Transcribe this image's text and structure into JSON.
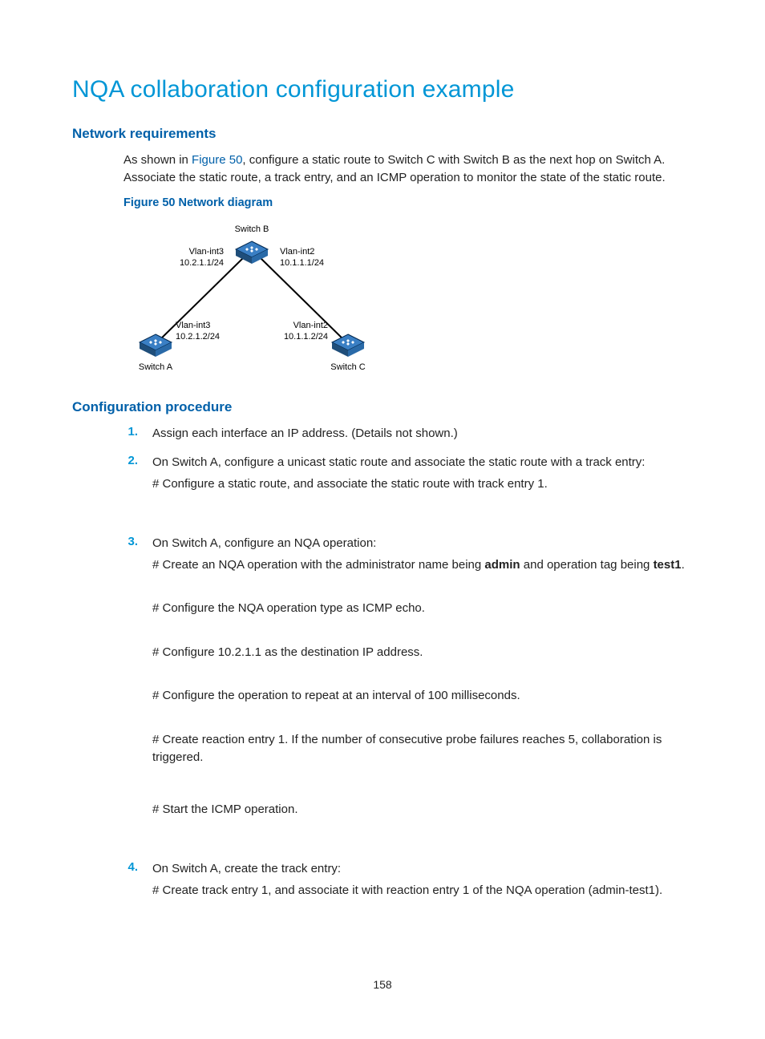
{
  "title": "NQA collaboration configuration example",
  "sections": {
    "netreq": {
      "heading": "Network requirements",
      "intro_pre": "As shown in ",
      "intro_link": "Figure 50",
      "intro_post": ", configure a static route to Switch C with Switch B as the next hop on Switch A. Associate the static route, a track entry, and an ICMP operation to monitor the state of the static route.",
      "fig_caption": "Figure 50 Network diagram"
    },
    "diagram": {
      "switch_b": "Switch B",
      "switch_a": "Switch A",
      "switch_c": "Switch C",
      "b_left_if": "Vlan-int3",
      "b_left_ip": "10.2.1.1/24",
      "b_right_if": "Vlan-int2",
      "b_right_ip": "10.1.1.1/24",
      "a_if": "Vlan-int3",
      "a_ip": "10.2.1.2/24",
      "c_if": "Vlan-int2",
      "c_ip": "10.1.1.2/24"
    },
    "config": {
      "heading": "Configuration procedure",
      "steps": [
        {
          "n": "1.",
          "lines": [
            "Assign each interface an IP address. (Details not shown.)"
          ]
        },
        {
          "n": "2.",
          "lines": [
            "On Switch A, configure a unicast static route and associate the static route with a track entry:",
            "# Configure a static route, and associate the static route with track entry 1."
          ]
        },
        {
          "n": "3.",
          "lines": [
            "On Switch A, configure an NQA operation:"
          ],
          "rich_line": {
            "pre": "# Create an NQA operation with the administrator name being ",
            "b1": "admin",
            "mid": " and operation tag being ",
            "b2": "test1",
            "post": "."
          },
          "after": [
            "# Configure the NQA operation type as ICMP echo.",
            "# Configure 10.2.1.1 as the destination IP address.",
            "# Configure the operation to repeat at an interval of 100 milliseconds.",
            "# Create reaction entry 1. If the number of consecutive probe failures reaches 5, collaboration is triggered.",
            "# Start the ICMP operation."
          ]
        },
        {
          "n": "4.",
          "lines": [
            "On Switch A, create the track entry:",
            "# Create track entry 1, and associate it with reaction entry 1 of the NQA operation (admin-test1)."
          ]
        }
      ]
    }
  },
  "page_number": "158"
}
